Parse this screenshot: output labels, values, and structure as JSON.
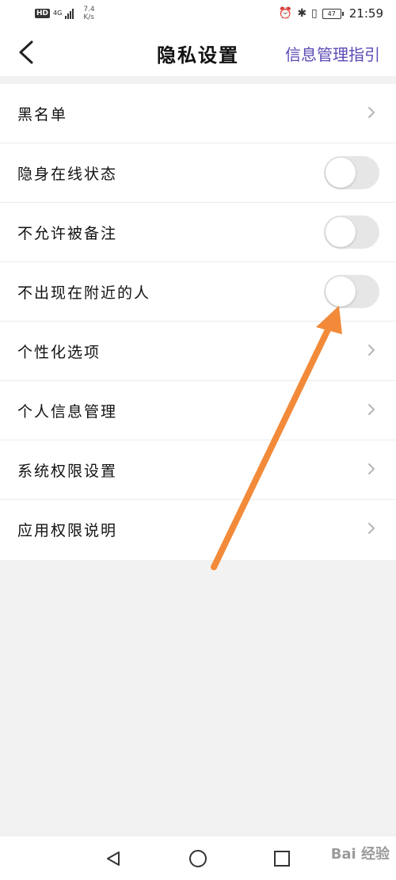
{
  "status_bar": {
    "hd": "HD",
    "network": "4G",
    "speed_value": "7.4",
    "speed_unit": "K/s",
    "battery": "47",
    "time": "21:59",
    "icons": [
      "alarm-icon",
      "bluetooth-icon",
      "vibrate-icon",
      "battery-icon"
    ]
  },
  "header": {
    "back_icon": "chevron-left-icon",
    "title": "隐私设置",
    "link": "信息管理指引",
    "link_color": "#5b4bb5"
  },
  "items": [
    {
      "label": "黑名单",
      "control": "chevron"
    },
    {
      "label": "隐身在线状态",
      "control": "toggle",
      "on": false
    },
    {
      "label": "不允许被备注",
      "control": "toggle",
      "on": false
    },
    {
      "label": "不出现在附近的人",
      "control": "toggle",
      "on": false
    },
    {
      "label": "个性化选项",
      "control": "chevron"
    },
    {
      "label": "个人信息管理",
      "control": "chevron"
    },
    {
      "label": "系统权限设置",
      "control": "chevron"
    },
    {
      "label": "应用权限说明",
      "control": "chevron"
    }
  ],
  "annotation": {
    "color": "#f28a3a"
  },
  "system_nav": {
    "icons": [
      "nav-back-icon",
      "nav-home-icon",
      "nav-recent-icon"
    ]
  },
  "watermark": "Bai 经验"
}
